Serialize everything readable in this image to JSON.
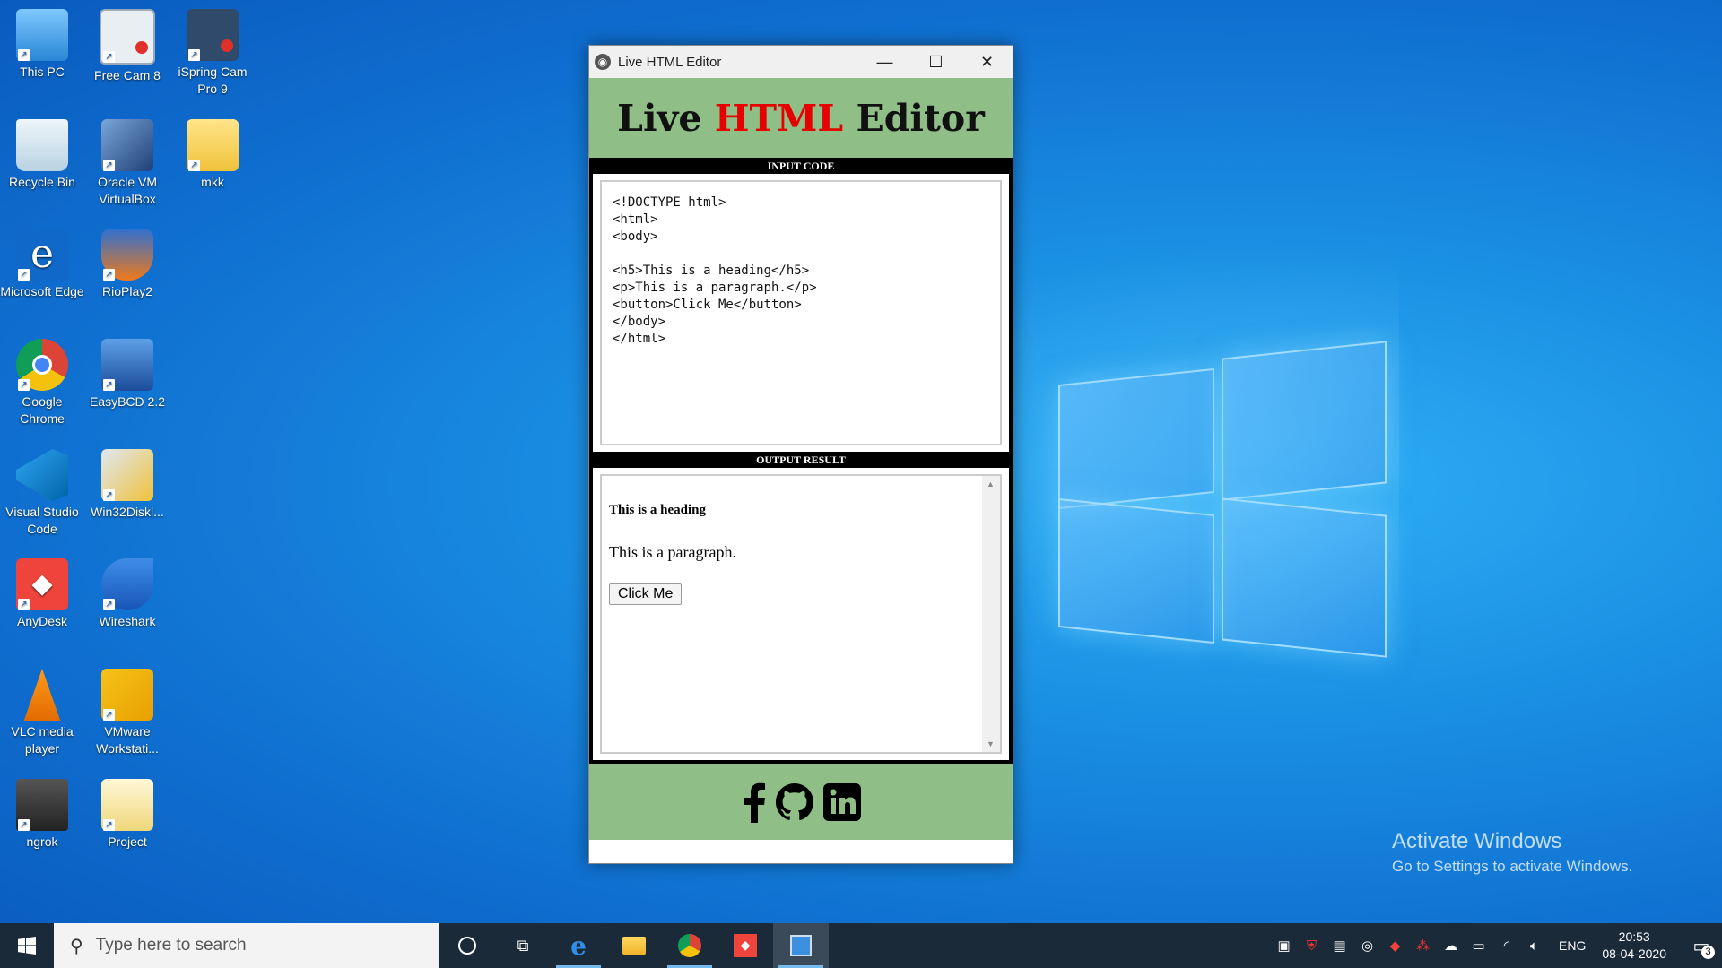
{
  "desktop": {
    "icons": [
      {
        "label": "This PC"
      },
      {
        "label": "Free Cam 8"
      },
      {
        "label": "iSpring Cam Pro 9"
      },
      {
        "label": "Recycle Bin"
      },
      {
        "label": "Oracle VM VirtualBox"
      },
      {
        "label": "mkk"
      },
      {
        "label": "Microsoft Edge"
      },
      {
        "label": "RioPlay2"
      },
      {
        "label": "Google Chrome"
      },
      {
        "label": "EasyBCD 2.2"
      },
      {
        "label": "Visual Studio Code"
      },
      {
        "label": "Win32Diskl..."
      },
      {
        "label": "AnyDesk"
      },
      {
        "label": "Wireshark"
      },
      {
        "label": "VLC media player"
      },
      {
        "label": "VMware Workstati..."
      },
      {
        "label": "ngrok"
      },
      {
        "label": "Project"
      }
    ]
  },
  "window": {
    "title": "Live HTML Editor",
    "minimize_glyph": "—",
    "maximize_glyph": "☐",
    "close_glyph": "✕"
  },
  "app": {
    "header_word1": "Live ",
    "header_word2": "HTML",
    "header_word3": " Editor",
    "input_label": "INPUT CODE",
    "code": "<!DOCTYPE html>\n<html>\n<body>\n\n<h5>This is a heading</h5>\n<p>This is a paragraph.</p>\n<button>Click Me</button>\n</body>\n</html>",
    "output_label": "OUTPUT RESULT",
    "output_heading": "This is a heading",
    "output_paragraph": "This is a paragraph.",
    "output_button": "Click Me",
    "social_icons": [
      "facebook-icon",
      "github-icon",
      "linkedin-icon"
    ]
  },
  "watermark": {
    "line1": "Activate Windows",
    "line2": "Go to Settings to activate Windows."
  },
  "taskbar": {
    "search_placeholder": "Type here to search",
    "language": "ENG",
    "time": "20:53",
    "date": "08-04-2020",
    "notification_count": "3"
  },
  "colors": {
    "header_green": "#8fbf87",
    "accent_red": "#e60000",
    "taskbar": "#1b2a38"
  }
}
